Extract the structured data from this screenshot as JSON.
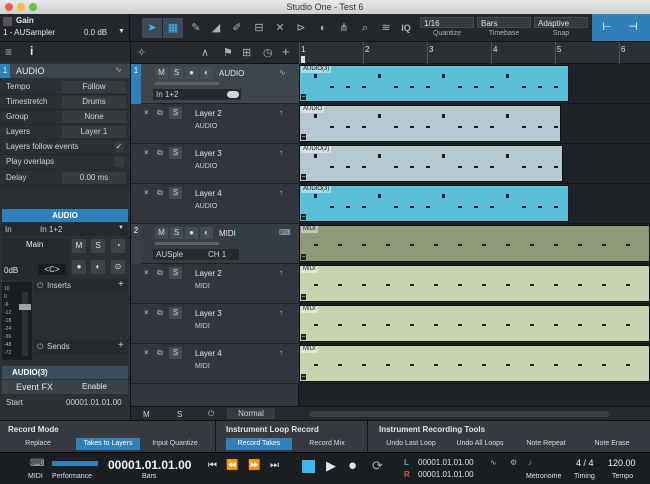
{
  "window": {
    "title": "Studio One - Test 6"
  },
  "toolbar": {
    "instrument_name": "Gain",
    "instrument_preset": "1 - AUSampler",
    "gain_value": "0.0 dB",
    "iq_label": "IQ",
    "quantize_value": "1/16",
    "quantize_label": "Quantize",
    "timebase_value": "Bars",
    "timebase_label": "Timebase",
    "snap_value": "Adaptive",
    "snap_label": "Snap"
  },
  "inspector": {
    "info_label": "i",
    "track_number": "1",
    "track_name": "AUDIO",
    "rows": [
      {
        "key": "Tempo",
        "value": "Follow"
      },
      {
        "key": "Timestretch",
        "value": "Drums"
      },
      {
        "key": "Group",
        "value": "None"
      },
      {
        "key": "Layers",
        "value": "Layer 1"
      }
    ],
    "layers_follow_events": "Layers follow events",
    "play_overlaps": "Play overlaps",
    "delay_label": "Delay",
    "delay_value": "0.00 ms",
    "channel_header": "AUDIO",
    "input_label": "In",
    "input_value": "In 1+2",
    "main_label": "Main",
    "volume_value": "0dB",
    "pan_value": "<C>",
    "inserts_label": "Inserts",
    "sends_label": "Sends",
    "event_header": "AUDIO(3)",
    "event_fx_label": "Event FX",
    "enable_label": "Enable",
    "start_label": "Start",
    "start_value": "00001.01.01.00",
    "meter_ticks": [
      "10",
      "0",
      "-6",
      "-12",
      "-18",
      "-24",
      "-36",
      "-48",
      "-72"
    ]
  },
  "tracks": [
    {
      "num": "1",
      "name": "AUDIO",
      "kind": "folder",
      "input": "In 1+2"
    },
    {
      "name": "Layer 2",
      "sub": "AUDIO"
    },
    {
      "name": "Layer 3",
      "sub": "AUDIO"
    },
    {
      "name": "Layer 4",
      "sub": "AUDIO"
    },
    {
      "num": "2",
      "name": "MIDI",
      "kind": "folder",
      "input": "AUSple",
      "channel": "CH 1"
    },
    {
      "name": "Layer 2",
      "sub": "MIDI"
    },
    {
      "name": "Layer 3",
      "sub": "MIDI"
    },
    {
      "name": "Layer 4",
      "sub": "MIDI"
    }
  ],
  "track_buttons": {
    "mute": "M",
    "solo": "S",
    "close": "×"
  },
  "tracklist_footer": {
    "mute": "M",
    "solo": "S",
    "mode": "Normal"
  },
  "ruler": {
    "marks": [
      "1",
      "2",
      "3",
      "4",
      "5",
      "6"
    ]
  },
  "events": [
    {
      "label": "AUDIO(3)",
      "color": "#5bbfd8"
    },
    {
      "label": "AUDIO",
      "color": "#b7c8d0"
    },
    {
      "label": "AUDIO(2)",
      "color": "#b7c8d0"
    },
    {
      "label": "AUDIO(3)",
      "color": "#5bbfd8"
    },
    {
      "label": "MIDI",
      "color": "#8f9877"
    },
    {
      "label": "MIDI",
      "color": "#c8d3b0"
    },
    {
      "label": "MIDI",
      "color": "#c8d3b0"
    },
    {
      "label": "MIDI",
      "color": "#c8d3b0"
    }
  ],
  "bottom": {
    "record_mode": {
      "title": "Record Mode",
      "buttons": [
        "Replace",
        "Takes to Layers",
        "Input Quantize"
      ],
      "selected": 1
    },
    "loop_record": {
      "title": "Instrument Loop Record",
      "buttons": [
        "Record Takes",
        "Record Mix"
      ],
      "selected": 0
    },
    "tools": {
      "title": "Instrument Recording Tools",
      "buttons": [
        "Undo Last Loop",
        "Undo All Loops",
        "Note Repeat",
        "Note Erase"
      ]
    }
  },
  "transport": {
    "midi_label": "MIDI",
    "performance_label": "Performance",
    "time": "00001.01.01.00",
    "time_label": "Bars",
    "loop_l_label": "L",
    "loop_r_label": "R",
    "loop_l": "00001.01.01.00",
    "loop_r": "00001.01.01.00",
    "metronome_label": "Metronome",
    "timing_value": "4 / 4",
    "timing_label": "Timing",
    "tempo_value": "120.00",
    "tempo_label": "Tempo"
  },
  "colors": {
    "accent": "#2f80b8",
    "highlight": "#3fb6ef",
    "record": "#e25050"
  }
}
